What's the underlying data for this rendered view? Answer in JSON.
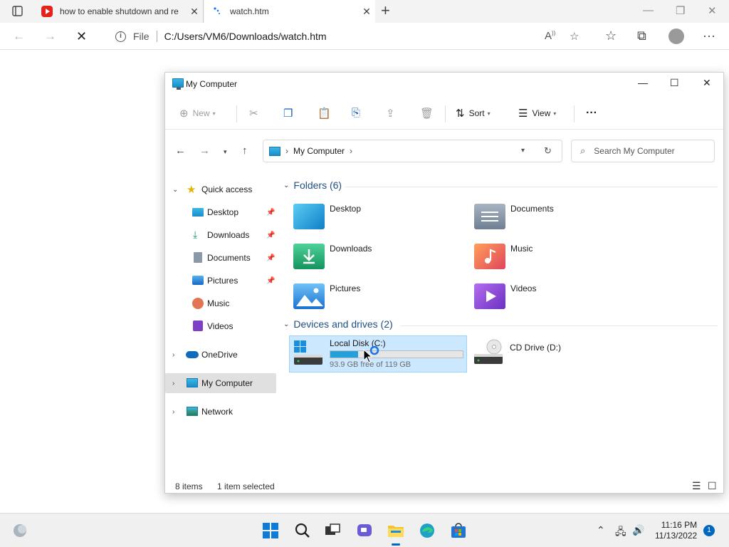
{
  "browser": {
    "tabs": [
      {
        "title": "how to enable shutdown and re",
        "icon": "youtube-icon"
      },
      {
        "title": "watch.htm",
        "icon": "loading-icon"
      }
    ],
    "address": {
      "scheme_label": "File",
      "url": "C:/Users/VM6/Downloads/watch.htm"
    }
  },
  "explorer": {
    "title": "My Computer",
    "toolbar": {
      "new_label": "New",
      "sort_label": "Sort",
      "view_label": "View"
    },
    "breadcrumb": {
      "location": "My Computer"
    },
    "search": {
      "placeholder": "Search My Computer"
    },
    "sidebar": {
      "quick_access": "Quick access",
      "pinned": [
        "Desktop",
        "Downloads",
        "Documents",
        "Pictures"
      ],
      "unpinned": [
        "Music",
        "Videos"
      ],
      "onedrive": "OneDrive",
      "my_computer": "My Computer",
      "network": "Network"
    },
    "folders_header": "Folders (6)",
    "folders": [
      "Desktop",
      "Documents",
      "Downloads",
      "Music",
      "Pictures",
      "Videos"
    ],
    "drives_header": "Devices and drives (2)",
    "drives": [
      {
        "name": "Local Disk (C:)",
        "free": "93.9 GB free of 119 GB",
        "used_fraction": 0.21
      },
      {
        "name": "CD Drive (D:)"
      }
    ],
    "status": {
      "count": "8 items",
      "selection": "1 item selected"
    }
  },
  "taskbar": {
    "time": "11:16 PM",
    "date": "11/13/2022",
    "notifications": "1"
  },
  "colors": {
    "accent": "#0067c0",
    "drive_bar": "#26a0da",
    "selection": "#cce8ff"
  }
}
